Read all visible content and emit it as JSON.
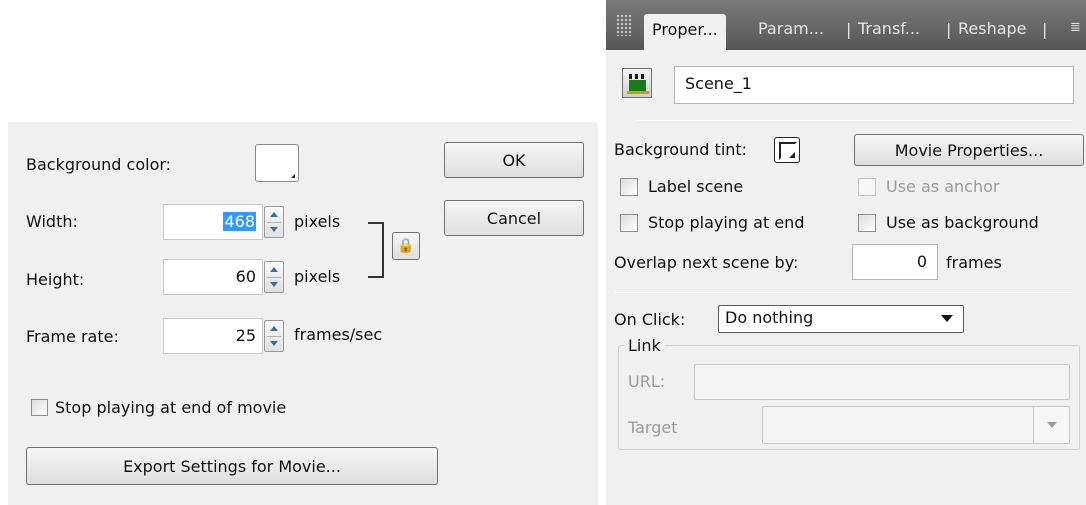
{
  "movie_dialog": {
    "background_color_label": "Background color:",
    "width_label": "Width:",
    "width_value": "468",
    "width_unit": "pixels",
    "height_label": "Height:",
    "height_value": "60",
    "height_unit": "pixels",
    "frame_rate_label": "Frame rate:",
    "frame_rate_value": "25",
    "frame_rate_unit": "frames/sec",
    "stop_playing_label": "Stop playing at end of movie",
    "export_button": "Export Settings for Movie...",
    "ok_button": "OK",
    "cancel_button": "Cancel"
  },
  "properties_panel": {
    "tabs": [
      "Proper...",
      "Param...",
      "Transf...",
      "Reshape"
    ],
    "active_tab": "Proper...",
    "scene_name": "Scene_1",
    "background_tint_label": "Background tint:",
    "movie_properties_button": "Movie Properties...",
    "label_scene": "Label scene",
    "use_as_anchor": "Use as anchor",
    "stop_playing_at_end": "Stop playing at end",
    "use_as_background": "Use as background",
    "overlap_label": "Overlap next scene by:",
    "overlap_value": "0",
    "overlap_unit": "frames",
    "on_click_label": "On Click:",
    "on_click_value": "Do nothing",
    "link_group_label": "Link",
    "url_label": "URL:",
    "target_label": "Target"
  }
}
